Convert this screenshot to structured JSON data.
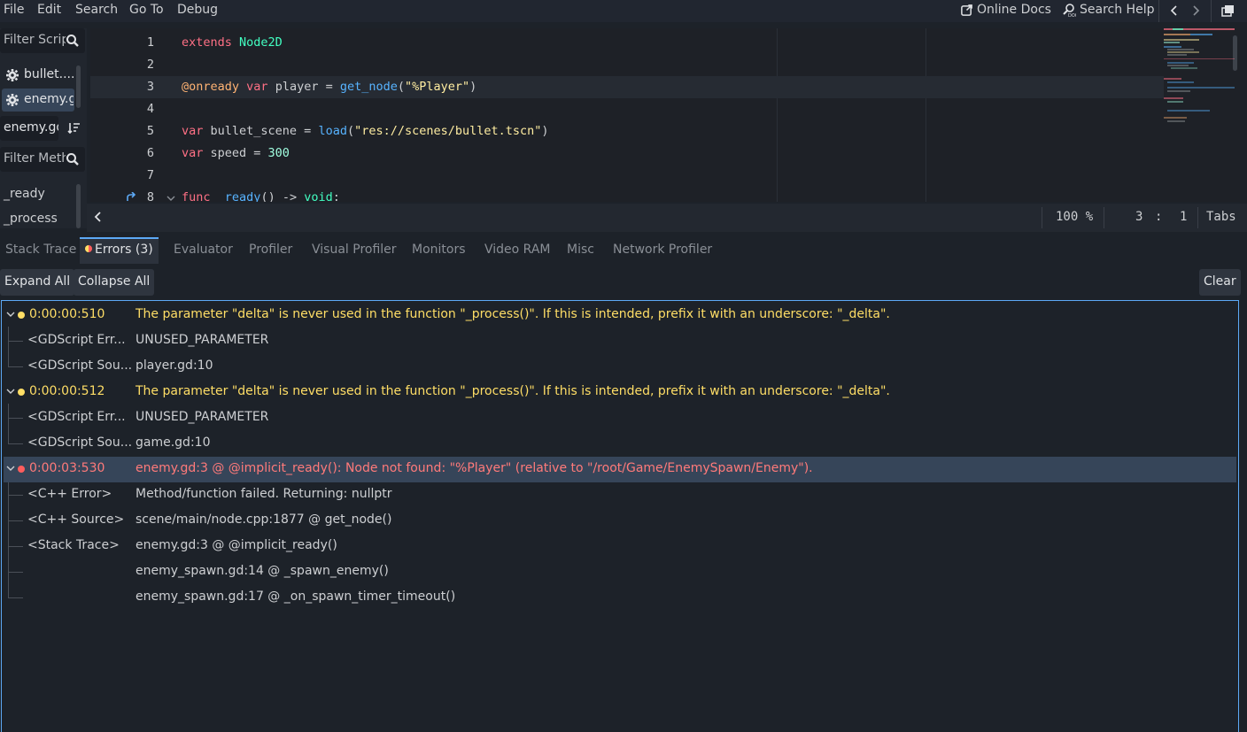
{
  "menu": {
    "file": "File",
    "edit": "Edit",
    "search": "Search",
    "goto": "Go To",
    "debug": "Debug"
  },
  "top_right": {
    "online_docs": "Online Docs",
    "search_help": "Search Help",
    "back_icon": "chevron-left-icon",
    "forward_icon": "chevron-right-icon",
    "distraction_icon": "window-icon"
  },
  "left_panel": {
    "filter_scripts_placeholder": "Filter Scrip",
    "scripts": [
      {
        "label": "bullet...."
      },
      {
        "label": "enemy.g"
      }
    ],
    "current_script": "enemy.gd",
    "filter_methods_placeholder": "Filter Meth",
    "methods": [
      "_ready",
      "_process"
    ]
  },
  "editor": {
    "line_numbers": [
      "1",
      "2",
      "3",
      "4",
      "5",
      "6",
      "7",
      "8"
    ],
    "lines": [
      [
        {
          "t": "extends",
          "c": "kw"
        },
        {
          "t": " ",
          "c": ""
        },
        {
          "t": "Node2D",
          "c": "ty"
        }
      ],
      [],
      [
        {
          "t": "@onready",
          "c": "ann"
        },
        {
          "t": " ",
          "c": ""
        },
        {
          "t": "var",
          "c": "kw"
        },
        {
          "t": " player = ",
          "c": ""
        },
        {
          "t": "get_node",
          "c": "fn"
        },
        {
          "t": "(",
          "c": ""
        },
        {
          "t": "\"%Player\"",
          "c": "str"
        },
        {
          "t": ")",
          "c": ""
        }
      ],
      [],
      [
        {
          "t": "var",
          "c": "kw"
        },
        {
          "t": " bullet_scene = ",
          "c": ""
        },
        {
          "t": "load",
          "c": "fn"
        },
        {
          "t": "(",
          "c": ""
        },
        {
          "t": "\"res://scenes/bullet.tscn\"",
          "c": "str"
        },
        {
          "t": ")",
          "c": ""
        }
      ],
      [
        {
          "t": "var",
          "c": "kw"
        },
        {
          "t": " speed = ",
          "c": ""
        },
        {
          "t": "300",
          "c": "num"
        }
      ],
      [],
      [
        {
          "t": "func",
          "c": "kw"
        },
        {
          "t": " ",
          "c": ""
        },
        {
          "t": "_ready",
          "c": "fn"
        },
        {
          "t": "() -> ",
          "c": ""
        },
        {
          "t": "void",
          "c": "ty"
        },
        {
          "t": ":",
          "c": ""
        }
      ]
    ],
    "active_line": 3
  },
  "status": {
    "zoom": "100 %",
    "line": "3",
    "col": "1",
    "indent": "Tabs"
  },
  "debugger_tabs": [
    {
      "label": "Stack Trace",
      "active": false
    },
    {
      "label": "Errors (3)",
      "active": true
    },
    {
      "label": "Evaluator",
      "active": false
    },
    {
      "label": "Profiler",
      "active": false
    },
    {
      "label": "Visual Profiler",
      "active": false
    },
    {
      "label": "Monitors",
      "active": false
    },
    {
      "label": "Video RAM",
      "active": false
    },
    {
      "label": "Misc",
      "active": false
    },
    {
      "label": "Network Profiler",
      "active": false
    }
  ],
  "toolbar": {
    "expand_all": "Expand All",
    "collapse_all": "Collapse All",
    "clear": "Clear"
  },
  "errors": [
    {
      "type": "warning",
      "time": "0:00:00:510",
      "message": "The parameter \"delta\" is never used in the function \"_process()\". If this is intended, prefix it with an underscore: \"_delta\".",
      "children": [
        {
          "label": "<GDScript Err...",
          "value": "UNUSED_PARAMETER"
        },
        {
          "label": "<GDScript Sou...",
          "value": "player.gd:10"
        }
      ]
    },
    {
      "type": "warning",
      "time": "0:00:00:512",
      "message": "The parameter \"delta\" is never used in the function \"_process()\". If this is intended, prefix it with an underscore: \"_delta\".",
      "children": [
        {
          "label": "<GDScript Err...",
          "value": "UNUSED_PARAMETER"
        },
        {
          "label": "<GDScript Sou...",
          "value": "game.gd:10"
        }
      ]
    },
    {
      "type": "error",
      "time": "0:00:03:530",
      "message": "enemy.gd:3 @ @implicit_ready(): Node not found: \"%Player\" (relative to \"/root/Game/EnemySpawn/Enemy\").",
      "children": [
        {
          "label": "<C++ Error>",
          "value": "Method/function failed. Returning: nullptr"
        },
        {
          "label": "<C++ Source>",
          "value": "scene/main/node.cpp:1877 @ get_node()"
        },
        {
          "label": "<Stack Trace>",
          "value": "enemy.gd:3 @ @implicit_ready()"
        },
        {
          "label": "",
          "value": "enemy_spawn.gd:14 @ _spawn_enemy()"
        },
        {
          "label": "",
          "value": "enemy_spawn.gd:17 @ _on_spawn_timer_timeout()"
        }
      ]
    }
  ],
  "colors": {
    "warning": "#ffde66",
    "error": "#ff7a7a",
    "accent": "#5da9f5",
    "selected_row": "#364559"
  }
}
